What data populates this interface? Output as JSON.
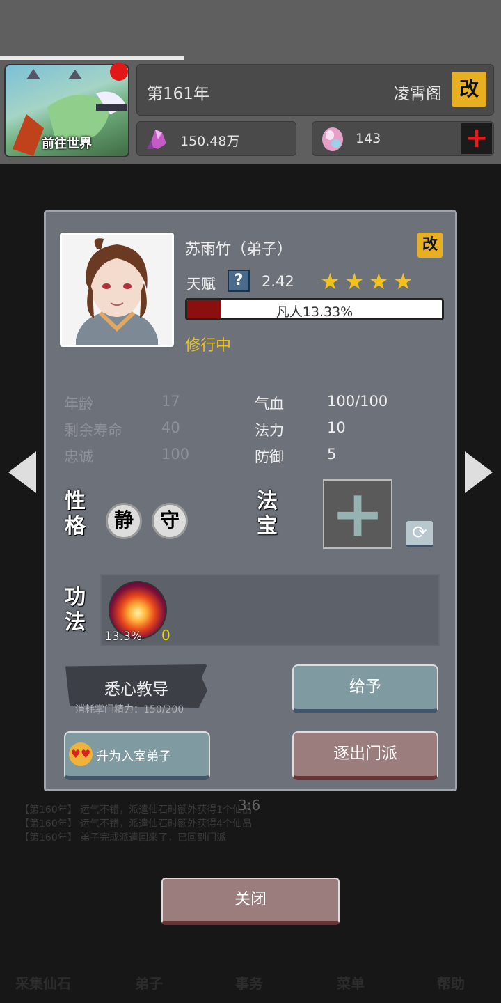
{
  "header": {
    "world_button_label": "前往世界",
    "year": "第161年",
    "sect_name": "凌霄阁",
    "rename_icon": "改",
    "spirit_stones": "150.48万",
    "gems": "143",
    "add_icon": "+"
  },
  "background": {
    "logs": [
      "【第160年】 运气不错，派遣仙石时额外获得1个仙晶",
      "【第160年】 运气不错，派遣仙石时额外获得4个仙晶",
      "【第160年】 弟子完成派遣回来了，已回到门派"
    ],
    "page_indicator": "3:6",
    "nav": [
      "采集仙石",
      "弟子",
      "事务",
      "菜单",
      "帮助"
    ]
  },
  "disciple": {
    "name": "苏雨竹（弟子）",
    "rename_icon": "改",
    "talent_label": "天赋",
    "help_icon": "?",
    "talent_value": "2.42",
    "stars": 4,
    "realm_text": "凡人13.33%",
    "realm_progress": 0.1333,
    "status": "修行中",
    "stats_left": [
      {
        "label": "年龄",
        "value": "17"
      },
      {
        "label": "剩余寿命",
        "value": "40"
      },
      {
        "label": "忠诚",
        "value": "100"
      }
    ],
    "stats_right": [
      {
        "label": "气血",
        "value": "100/100"
      },
      {
        "label": "法力",
        "value": "10"
      },
      {
        "label": "防御",
        "value": "5"
      }
    ],
    "personality_title": "性格",
    "traits": [
      "静",
      "守"
    ],
    "artifact_title": "法宝",
    "skill_title": "功法",
    "skill_progress": "13.3%",
    "skill_level": "0"
  },
  "actions": {
    "teach_label": "悉心教导",
    "teach_cost": "消耗掌门精力：150/200",
    "give_label": "给予",
    "promote_label": "升为入室弟子",
    "expel_label": "逐出门派",
    "close_label": "关闭"
  },
  "colors": {
    "accent_gold": "#e8b020",
    "realm_fill": "#8b0f0f",
    "status_yellow": "#e9c21d",
    "dialog_bg": "#6d717a"
  }
}
